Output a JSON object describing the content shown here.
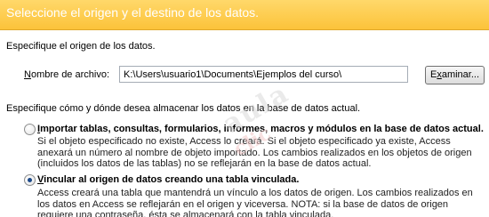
{
  "header": {
    "title": "Seleccione el origen y el destino de los datos."
  },
  "source": {
    "label": "Especifique el origen de los datos.",
    "file_label": "Nombre de archivo:",
    "file_value": "K:\\Users\\usuario1\\Documents\\Ejemplos del curso\\",
    "browse_label": "Examinar..."
  },
  "storage": {
    "label": "Especifique cómo y dónde desea almacenar los datos en la base de datos actual.",
    "options": [
      {
        "title": "Importar tablas, consultas, formularios, informes, macros y módulos en la base de datos actual.",
        "desc": "Si el objeto especificado no existe, Access lo creará. Si el objeto especificado ya existe, Access anexará un número al nombre de objeto importado. Los cambios realizados en los objetos de origen (incluidos los datos de las tablas) no se reflejarán en la base de datos actual.",
        "selected": false
      },
      {
        "title": "Vincular al origen de datos creando una tabla vinculada.",
        "desc": "Access creará una tabla que mantendrá un vínculo a los datos de origen. Los cambios realizados en los datos en Access se reflejarán en el origen y viceversa. NOTA: si la base de datos de origen requiere una contraseña, ésta se almacenará con la tabla vinculada.",
        "selected": true
      }
    ]
  },
  "colors": {
    "header_bg": "#fcc33a",
    "header_text": "#ffffff",
    "radio_dot": "#1d4a8a"
  }
}
